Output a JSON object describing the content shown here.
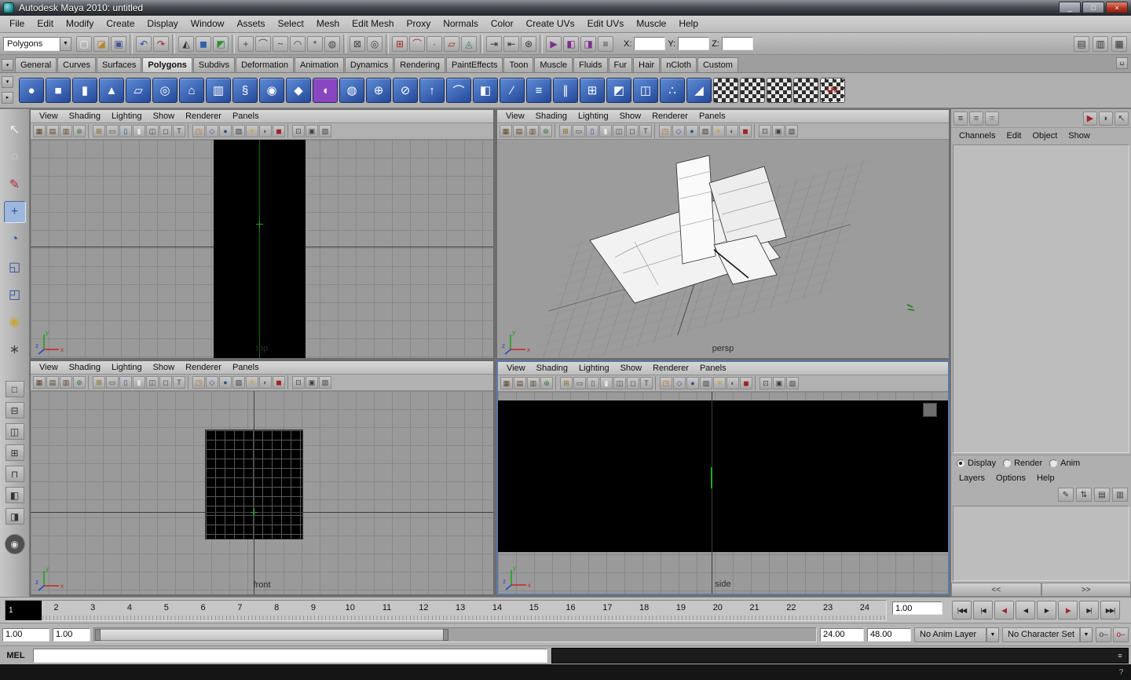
{
  "window": {
    "title": "Autodesk Maya 2010: untitled"
  },
  "titlebar": {
    "buttons": [
      {
        "name": "minimize-button",
        "g": "_"
      },
      {
        "name": "maximize-button",
        "g": "□"
      },
      {
        "name": "close-button",
        "g": "×",
        "cls": "close"
      }
    ]
  },
  "menubar": {
    "items": [
      "File",
      "Edit",
      "Modify",
      "Create",
      "Display",
      "Window",
      "Assets",
      "Select",
      "Mesh",
      "Edit Mesh",
      "Proxy",
      "Normals",
      "Color",
      "Create UVs",
      "Edit UVs",
      "Muscle",
      "Help"
    ]
  },
  "statusline": {
    "mode_selector": "Polygons",
    "icons": [
      {
        "name": "new-scene-icon",
        "g": "▢",
        "fg": "#f2f2f2"
      },
      {
        "name": "open-scene-icon",
        "g": "◪",
        "fg": "#b8812a"
      },
      {
        "name": "save-scene-icon",
        "g": "▣",
        "fg": "#46568f"
      },
      {
        "name": "separator",
        "cls": "sep",
        "inter": "false"
      },
      {
        "name": "undo-icon",
        "g": "↶",
        "fg": "#1f4e9e"
      },
      {
        "name": "redo-icon",
        "g": "↷",
        "fg": "#9e1f1f"
      },
      {
        "name": "separator",
        "cls": "sep",
        "inter": "false"
      },
      {
        "name": "select-hierarchy-icon",
        "g": "◭",
        "fg": "#333333"
      },
      {
        "name": "select-object-icon",
        "g": "◼",
        "fg": "#2f5fae"
      },
      {
        "name": "select-component-icon",
        "g": "◩",
        "fg": "#2f8f2f"
      },
      {
        "name": "separator",
        "cls": "sep",
        "inter": "false"
      },
      {
        "name": "mask-handles-icon",
        "g": "+",
        "fg": "#444444"
      },
      {
        "name": "mask-joints-icon",
        "g": "⌒",
        "fg": "#444444"
      },
      {
        "name": "mask-curves-icon",
        "g": "~",
        "fg": "#444444"
      },
      {
        "name": "mask-surfaces-icon",
        "g": "◠",
        "fg": "#444444"
      },
      {
        "name": "mask-dynamics-icon",
        "g": "*",
        "fg": "#444444"
      },
      {
        "name": "mask-rendering-icon",
        "g": "◍",
        "fg": "#444444"
      },
      {
        "name": "separator",
        "cls": "sep",
        "inter": "false"
      },
      {
        "name": "lock-selection-icon",
        "g": "⊠",
        "fg": "#444444"
      },
      {
        "name": "highlight-selection-icon",
        "g": "◎",
        "fg": "#444444"
      },
      {
        "name": "separator",
        "cls": "sep",
        "inter": "false"
      },
      {
        "name": "snap-to-grid-icon",
        "g": "⊞",
        "fg": "#a32828"
      },
      {
        "name": "snap-to-curve-icon",
        "g": "⌒",
        "fg": "#a32828"
      },
      {
        "name": "snap-to-point-icon",
        "g": "∙",
        "fg": "#a32828"
      },
      {
        "name": "snap-to-view-plane-icon",
        "g": "▱",
        "fg": "#a32828"
      },
      {
        "name": "make-live-icon",
        "g": "◬",
        "fg": "#2e7d4f"
      },
      {
        "name": "separator",
        "cls": "sep",
        "inter": "false"
      },
      {
        "name": "input-connections-icon",
        "g": "⇥",
        "fg": "#333333"
      },
      {
        "name": "output-connections-icon",
        "g": "⇤",
        "fg": "#333333"
      },
      {
        "name": "construction-history-icon",
        "g": "⊛",
        "fg": "#333333"
      },
      {
        "name": "separator",
        "cls": "sep",
        "inter": "false"
      },
      {
        "name": "open-render-view-icon",
        "g": "▶",
        "fg": "#7a2e8f"
      },
      {
        "name": "render-current-frame-icon",
        "g": "◧",
        "fg": "#7a2e8f"
      },
      {
        "name": "ipr-render-icon",
        "g": "◨",
        "fg": "#7a2e8f"
      },
      {
        "name": "render-settings-icon",
        "g": "≡",
        "fg": "#444444"
      }
    ],
    "coords": [
      {
        "label": "X:"
      },
      {
        "label": "Y:"
      },
      {
        "label": "Z:"
      }
    ],
    "right_icons": [
      {
        "name": "attribute-editor-toggle-icon",
        "g": "▤",
        "fg": "#333333"
      },
      {
        "name": "tool-settings-toggle-icon",
        "g": "▥",
        "fg": "#333333"
      },
      {
        "name": "channel-box-toggle-icon",
        "g": "▦",
        "fg": "#333333"
      }
    ]
  },
  "shelf": {
    "tabs": [
      {
        "label": "General"
      },
      {
        "label": "Curves"
      },
      {
        "label": "Surfaces"
      },
      {
        "label": "Polygons",
        "cls": "active"
      },
      {
        "label": "Subdivs"
      },
      {
        "label": "Deformation"
      },
      {
        "label": "Animation"
      },
      {
        "label": "Dynamics"
      },
      {
        "label": "Rendering"
      },
      {
        "label": "PaintEffects"
      },
      {
        "label": "Toon"
      },
      {
        "label": "Muscle"
      },
      {
        "label": "Fluids"
      },
      {
        "label": "Fur"
      },
      {
        "label": "Hair"
      },
      {
        "label": "nCloth"
      },
      {
        "label": "Custom"
      }
    ],
    "tab_menu_glyph": "▾",
    "trash_glyph": "⊔",
    "lead_buttons": [
      {
        "name": "shelf-tabs-toggle-icon",
        "g": "▾"
      },
      {
        "name": "shelf-menu-icon",
        "g": "▸"
      }
    ],
    "icons": [
      {
        "name": "poly-sphere-icon",
        "g": "●"
      },
      {
        "name": "poly-cube-icon",
        "g": "■"
      },
      {
        "name": "poly-cylinder-icon",
        "g": "▮"
      },
      {
        "name": "poly-cone-icon",
        "g": "▲"
      },
      {
        "name": "poly-plane-icon",
        "g": "▱"
      },
      {
        "name": "poly-torus-icon",
        "g": "◎"
      },
      {
        "name": "poly-prism-icon",
        "g": "⌂"
      },
      {
        "name": "poly-pipe-icon",
        "g": "▥"
      },
      {
        "name": "poly-helix-icon",
        "g": "§"
      },
      {
        "name": "poly-soccer-ball-icon",
        "g": "◉"
      },
      {
        "name": "poly-platonic-icon",
        "g": "◆"
      },
      {
        "name": "sculpt-geometry-icon",
        "g": "◖",
        "bg": "#8a46c0"
      },
      {
        "name": "poly-smooth-icon",
        "g": "◍"
      },
      {
        "name": "combine-icon",
        "g": "⊕"
      },
      {
        "name": "separate-icon",
        "g": "⊘"
      },
      {
        "name": "extrude-icon",
        "g": "↑"
      },
      {
        "name": "bridge-icon",
        "g": "⌒"
      },
      {
        "name": "append-polygon-icon",
        "g": "◧"
      },
      {
        "name": "split-polygon-icon",
        "g": "∕"
      },
      {
        "name": "insert-edge-loop-icon",
        "g": "≡"
      },
      {
        "name": "offset-edge-loop-icon",
        "g": "∥"
      },
      {
        "name": "add-divisions-icon",
        "g": "⊞"
      },
      {
        "name": "bevel-icon",
        "g": "◩"
      },
      {
        "name": "mirror-geometry-icon",
        "g": "◫"
      },
      {
        "name": "merge-vertices-icon",
        "g": "∴"
      },
      {
        "name": "crease-tool-icon",
        "g": "◢"
      },
      {
        "name": "planar-mapping-icon",
        "g": "",
        "cls": "checker"
      },
      {
        "name": "cylindrical-mapping-icon",
        "g": "",
        "cls": "checker"
      },
      {
        "name": "spherical-mapping-icon",
        "g": "",
        "cls": "checker"
      },
      {
        "name": "automatic-mapping-icon",
        "g": "",
        "cls": "checker"
      },
      {
        "name": "uv-texture-editor-icon",
        "g": "UV",
        "cls": "checker sel"
      }
    ]
  },
  "toolbox": {
    "tools": [
      {
        "name": "select-tool-icon",
        "g": "↖",
        "fg": "#f0f0f0"
      },
      {
        "name": "lasso-tool-icon",
        "g": "◌",
        "fg": "#e0e0e0"
      },
      {
        "name": "paint-selection-tool-icon",
        "g": "✎",
        "fg": "#b03030"
      },
      {
        "name": "move-tool-icon",
        "g": "+",
        "fg": "#2b52a8",
        "cls": "active"
      },
      {
        "name": "rotate-tool-icon",
        "g": "◔",
        "fg": "#2b52a8"
      },
      {
        "name": "scale-tool-icon",
        "g": "◱",
        "fg": "#2b52a8"
      },
      {
        "name": "universal-manipulator-icon",
        "g": "◰",
        "fg": "#2b52a8"
      },
      {
        "name": "soft-modification-tool-icon",
        "g": "◉",
        "fg": "#c9a63a"
      },
      {
        "name": "show-manipulator-tool-icon",
        "g": "∗",
        "fg": "#444444"
      }
    ],
    "layouts": [
      {
        "name": "single-pane-layout-icon",
        "g": "□"
      },
      {
        "name": "two-panes-stacked-layout-icon",
        "g": "⊟"
      },
      {
        "name": "two-panes-side-layout-icon",
        "g": "◫"
      },
      {
        "name": "four-panes-layout-icon",
        "g": "⊞"
      },
      {
        "name": "three-panes-layout-icon",
        "g": "⊓"
      },
      {
        "name": "persp-outliner-layout-icon",
        "g": "◧"
      },
      {
        "name": "hypershade-layout-icon",
        "g": "◨"
      },
      {
        "name": "hotbox-icon",
        "g": "◉",
        "cls": "round"
      }
    ]
  },
  "vp_menu": {
    "items": [
      "View",
      "Shading",
      "Lighting",
      "Show",
      "Renderer",
      "Panels"
    ]
  },
  "vp_toolbar": {
    "icons": [
      {
        "name": "select-camera-icon",
        "g": "▦",
        "fg": "#5e4426"
      },
      {
        "name": "camera-attributes-icon",
        "g": "▤",
        "fg": "#5e4426"
      },
      {
        "name": "bookmarks-icon",
        "g": "▥",
        "fg": "#5e4426"
      },
      {
        "name": "image-plane-icon",
        "g": "⊛",
        "fg": "#2f6e2f"
      },
      {
        "name": "separator",
        "cls": "sep",
        "inter": "false"
      },
      {
        "name": "view-grid-icon",
        "g": "⊞",
        "fg": "#8a6d1f"
      },
      {
        "name": "film-gate-icon",
        "g": "▭",
        "fg": "#444444"
      },
      {
        "name": "resolution-gate-icon",
        "g": "▯",
        "fg": "#2f4f8f"
      },
      {
        "name": "gate-mask-icon",
        "g": "▮",
        "fg": "#e8e8e8"
      },
      {
        "name": "field-chart-icon",
        "g": "◫",
        "fg": "#444444"
      },
      {
        "name": "safe-action-icon",
        "g": "◻",
        "fg": "#444444"
      },
      {
        "name": "safe-title-icon",
        "g": "T",
        "fg": "#444444"
      },
      {
        "name": "separator",
        "cls": "sep",
        "inter": "false"
      },
      {
        "name": "frame-all-icon",
        "g": "◳",
        "fg": "#b5731f"
      },
      {
        "name": "wireframe-icon",
        "g": "◇",
        "fg": "#2f4f8f"
      },
      {
        "name": "smooth-shade-icon",
        "g": "●",
        "fg": "#2f4f8f"
      },
      {
        "name": "textured-icon",
        "g": "▨",
        "fg": "#3d3d3d"
      },
      {
        "name": "lights-icon",
        "g": "☀",
        "fg": "#c7a425"
      },
      {
        "name": "shadows-icon",
        "g": "◐",
        "fg": "#555555"
      },
      {
        "name": "use-default-material-icon",
        "g": "◼",
        "fg": "#a32222"
      },
      {
        "name": "separator",
        "cls": "sep",
        "inter": "false"
      },
      {
        "name": "isolate-select-icon",
        "g": "⊡",
        "fg": "#3d3d3d"
      },
      {
        "name": "texture-borders-icon",
        "g": "▣",
        "fg": "#3d3d3d"
      },
      {
        "name": "xray-icon",
        "g": "▧",
        "fg": "#3d3d3d"
      }
    ]
  },
  "viewports": {
    "top": {
      "label": "top"
    },
    "persp": {
      "label": "persp"
    },
    "front": {
      "label": "front"
    },
    "side": {
      "label": "side"
    }
  },
  "axis": {
    "x": "x",
    "y": "y",
    "z": "z"
  },
  "channel_box": {
    "top_icons_left": [
      {
        "name": "channel-box-display-icon",
        "g": "≡",
        "fg": "#333333"
      },
      {
        "name": "layer-editor-display-icon",
        "g": "≡",
        "fg": "#555555"
      },
      {
        "name": "channel-layer-split-icon",
        "g": "≡",
        "fg": "#777777"
      }
    ],
    "top_icons_right": [
      {
        "name": "channel-speed-icon",
        "g": "▶",
        "fg": "#a32222"
      },
      {
        "name": "channel-mode-icon",
        "g": "◗",
        "fg": "#444444"
      },
      {
        "name": "channel-select-icon",
        "g": "↖",
        "fg": "#444444"
      }
    ],
    "menus": [
      "Channels",
      "Edit",
      "Object",
      "Show"
    ]
  },
  "layer_panel": {
    "radios": [
      {
        "label": "Display",
        "cls": "on"
      },
      {
        "label": "Render"
      },
      {
        "label": "Anim"
      }
    ],
    "menus": [
      "Layers",
      "Options",
      "Help"
    ],
    "icons": [
      {
        "name": "edit-layer-icon",
        "g": "✎"
      },
      {
        "name": "reorder-layers-icon",
        "g": "⇅"
      },
      {
        "name": "new-empty-layer-icon",
        "g": "▤"
      },
      {
        "name": "new-layer-from-selection-icon",
        "g": "▥"
      }
    ],
    "pane_left": "<<",
    "pane_right": ">>"
  },
  "time_slider": {
    "current_frame": "1",
    "numbers": [
      "2",
      "3",
      "4",
      "5",
      "6",
      "7",
      "8",
      "9",
      "10",
      "11",
      "12",
      "13",
      "14",
      "15",
      "16",
      "17",
      "18",
      "19",
      "20",
      "21",
      "22",
      "23",
      "24"
    ],
    "current_time": "1.00",
    "playback": [
      {
        "name": "go-to-start-button",
        "g": "|◀◀"
      },
      {
        "name": "step-back-frame-button",
        "g": "|◀"
      },
      {
        "name": "step-back-key-button",
        "g": "◀|",
        "cls": "red"
      },
      {
        "name": "play-backwards-button",
        "g": "◀"
      },
      {
        "name": "play-forwards-button",
        "g": "▶"
      },
      {
        "name": "step-forward-key-button",
        "g": "|▶",
        "cls": "red"
      },
      {
        "name": "step-forward-frame-button",
        "g": "▶|"
      },
      {
        "name": "go-to-end-button",
        "g": "▶▶|"
      }
    ]
  },
  "range_slider": {
    "anim_start": "1.00",
    "play_start": "1.00",
    "play_end": "24.00",
    "anim_end": "48.00",
    "anim_layer": "No Anim Layer",
    "character_set": "No Character Set",
    "icons": [
      {
        "name": "set-key-icon",
        "g": "o–",
        "fg": "#444444"
      },
      {
        "name": "auto-keyframe-icon",
        "g": "o–",
        "cls": "red"
      }
    ]
  },
  "command_line": {
    "label": "MEL",
    "value": ""
  },
  "misc_icons": {
    "script_editor": "≡",
    "help_line": "?"
  },
  "colors": {
    "viewport_background": "#9a9a9a",
    "image_plane": "#000000",
    "active_viewport_border": "#5b79a8",
    "shelf_icon_blue": "#2f5fae",
    "origin_green": "#1faa1f"
  }
}
